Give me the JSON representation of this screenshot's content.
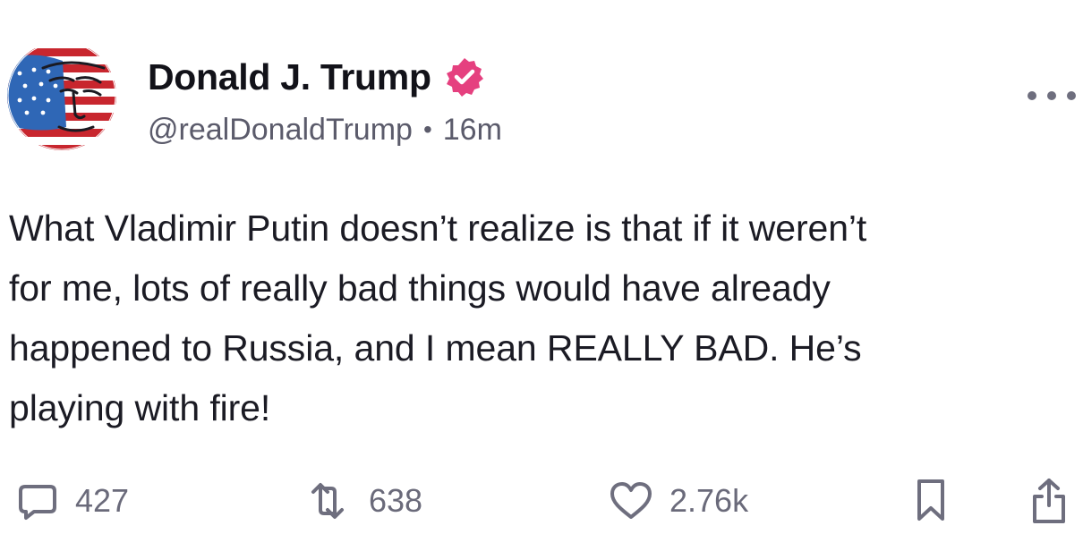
{
  "post": {
    "author": {
      "display_name": "Donald J. Trump",
      "handle": "@realDonaldTrump",
      "verified": true,
      "avatar_icon": "avatar-flag-portrait"
    },
    "separator": "•",
    "timestamp": "16m",
    "more_icon": "more-horizontal-icon",
    "text_lines": [
      "What Vladimir Putin doesn’t realize is that if it weren’t",
      "for me, lots of really bad things would have already",
      "happened to Russia, and I mean REALLY BAD. He’s",
      "playing with fire!"
    ],
    "actions": {
      "reply": {
        "icon": "reply-icon",
        "count": "427"
      },
      "retruth": {
        "icon": "retruth-icon",
        "count": "638"
      },
      "like": {
        "icon": "heart-icon",
        "count": "2.76k"
      },
      "bookmark": {
        "icon": "bookmark-icon"
      },
      "share": {
        "icon": "share-icon"
      }
    }
  },
  "colors": {
    "verified_badge": "#e5407f",
    "text_primary": "#1b1b24",
    "text_secondary": "#5b5b6b",
    "icon": "#6e6e7e"
  }
}
